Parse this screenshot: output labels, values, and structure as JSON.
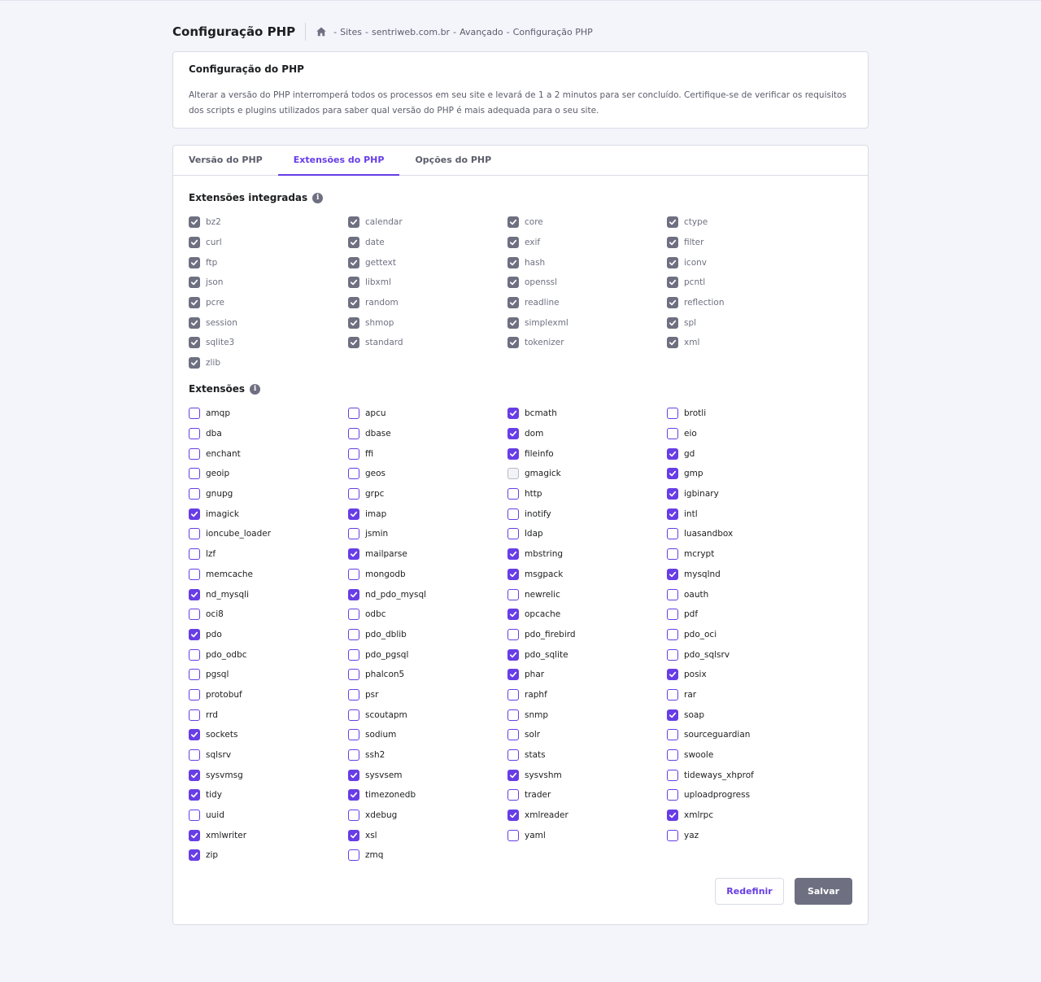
{
  "header": {
    "title": "Configuração PHP",
    "breadcrumb": [
      "Sites",
      "sentriweb.com.br",
      "Avançado",
      "Configuração PHP"
    ]
  },
  "info": {
    "title": "Configuração do PHP",
    "text": "Alterar a versão do PHP interromperá todos os processos em seu site e levará de 1 a 2 minutos para ser concluído. Certifique-se de verificar os requisitos dos scripts e plugins utilizados para saber qual versão do PHP é mais adequada para o seu site."
  },
  "tabs": [
    {
      "label": "Versão do PHP",
      "active": false
    },
    {
      "label": "Extensões do PHP",
      "active": true
    },
    {
      "label": "Opções do PHP",
      "active": false
    }
  ],
  "builtin_title": "Extensões integradas",
  "builtin": [
    "bz2",
    "calendar",
    "core",
    "ctype",
    "curl",
    "date",
    "exif",
    "filter",
    "ftp",
    "gettext",
    "hash",
    "iconv",
    "json",
    "libxml",
    "openssl",
    "pcntl",
    "pcre",
    "random",
    "readline",
    "reflection",
    "session",
    "shmop",
    "simplexml",
    "spl",
    "sqlite3",
    "standard",
    "tokenizer",
    "xml",
    "zlib"
  ],
  "extensions_title": "Extensões",
  "extensions": [
    {
      "name": "amqp",
      "checked": false
    },
    {
      "name": "apcu",
      "checked": false
    },
    {
      "name": "bcmath",
      "checked": true
    },
    {
      "name": "brotli",
      "checked": false
    },
    {
      "name": "dba",
      "checked": false
    },
    {
      "name": "dbase",
      "checked": false
    },
    {
      "name": "dom",
      "checked": true
    },
    {
      "name": "eio",
      "checked": false
    },
    {
      "name": "enchant",
      "checked": false
    },
    {
      "name": "ffi",
      "checked": false
    },
    {
      "name": "fileinfo",
      "checked": true
    },
    {
      "name": "gd",
      "checked": true
    },
    {
      "name": "geoip",
      "checked": false
    },
    {
      "name": "geos",
      "checked": false
    },
    {
      "name": "gmagick",
      "checked": false,
      "disabled": true
    },
    {
      "name": "gmp",
      "checked": true
    },
    {
      "name": "gnupg",
      "checked": false
    },
    {
      "name": "grpc",
      "checked": false
    },
    {
      "name": "http",
      "checked": false
    },
    {
      "name": "igbinary",
      "checked": true
    },
    {
      "name": "imagick",
      "checked": true
    },
    {
      "name": "imap",
      "checked": true
    },
    {
      "name": "inotify",
      "checked": false
    },
    {
      "name": "intl",
      "checked": true
    },
    {
      "name": "ioncube_loader",
      "checked": false
    },
    {
      "name": "jsmin",
      "checked": false
    },
    {
      "name": "ldap",
      "checked": false
    },
    {
      "name": "luasandbox",
      "checked": false
    },
    {
      "name": "lzf",
      "checked": false
    },
    {
      "name": "mailparse",
      "checked": true
    },
    {
      "name": "mbstring",
      "checked": true
    },
    {
      "name": "mcrypt",
      "checked": false
    },
    {
      "name": "memcache",
      "checked": false
    },
    {
      "name": "mongodb",
      "checked": false
    },
    {
      "name": "msgpack",
      "checked": true
    },
    {
      "name": "mysqlnd",
      "checked": true
    },
    {
      "name": "nd_mysqli",
      "checked": true
    },
    {
      "name": "nd_pdo_mysql",
      "checked": true
    },
    {
      "name": "newrelic",
      "checked": false
    },
    {
      "name": "oauth",
      "checked": false
    },
    {
      "name": "oci8",
      "checked": false
    },
    {
      "name": "odbc",
      "checked": false
    },
    {
      "name": "opcache",
      "checked": true
    },
    {
      "name": "pdf",
      "checked": false
    },
    {
      "name": "pdo",
      "checked": true
    },
    {
      "name": "pdo_dblib",
      "checked": false
    },
    {
      "name": "pdo_firebird",
      "checked": false
    },
    {
      "name": "pdo_oci",
      "checked": false
    },
    {
      "name": "pdo_odbc",
      "checked": false
    },
    {
      "name": "pdo_pgsql",
      "checked": false
    },
    {
      "name": "pdo_sqlite",
      "checked": true
    },
    {
      "name": "pdo_sqlsrv",
      "checked": false
    },
    {
      "name": "pgsql",
      "checked": false
    },
    {
      "name": "phalcon5",
      "checked": false
    },
    {
      "name": "phar",
      "checked": true
    },
    {
      "name": "posix",
      "checked": true
    },
    {
      "name": "protobuf",
      "checked": false
    },
    {
      "name": "psr",
      "checked": false
    },
    {
      "name": "raphf",
      "checked": false
    },
    {
      "name": "rar",
      "checked": false
    },
    {
      "name": "rrd",
      "checked": false
    },
    {
      "name": "scoutapm",
      "checked": false
    },
    {
      "name": "snmp",
      "checked": false
    },
    {
      "name": "soap",
      "checked": true
    },
    {
      "name": "sockets",
      "checked": true
    },
    {
      "name": "sodium",
      "checked": false
    },
    {
      "name": "solr",
      "checked": false
    },
    {
      "name": "sourceguardian",
      "checked": false
    },
    {
      "name": "sqlsrv",
      "checked": false
    },
    {
      "name": "ssh2",
      "checked": false
    },
    {
      "name": "stats",
      "checked": false
    },
    {
      "name": "swoole",
      "checked": false
    },
    {
      "name": "sysvmsg",
      "checked": true
    },
    {
      "name": "sysvsem",
      "checked": true
    },
    {
      "name": "sysvshm",
      "checked": true
    },
    {
      "name": "tideways_xhprof",
      "checked": false
    },
    {
      "name": "tidy",
      "checked": true
    },
    {
      "name": "timezonedb",
      "checked": true
    },
    {
      "name": "trader",
      "checked": false
    },
    {
      "name": "uploadprogress",
      "checked": false
    },
    {
      "name": "uuid",
      "checked": false
    },
    {
      "name": "xdebug",
      "checked": false
    },
    {
      "name": "xmlreader",
      "checked": true
    },
    {
      "name": "xmlrpc",
      "checked": true
    },
    {
      "name": "xmlwriter",
      "checked": true
    },
    {
      "name": "xsl",
      "checked": true
    },
    {
      "name": "yaml",
      "checked": false
    },
    {
      "name": "yaz",
      "checked": false
    },
    {
      "name": "zip",
      "checked": true
    },
    {
      "name": "zmq",
      "checked": false
    }
  ],
  "buttons": {
    "reset": "Redefinir",
    "save": "Salvar"
  },
  "colors": {
    "accent": "#673de6",
    "muted": "#6e7081",
    "background": "#f4f4fb"
  }
}
